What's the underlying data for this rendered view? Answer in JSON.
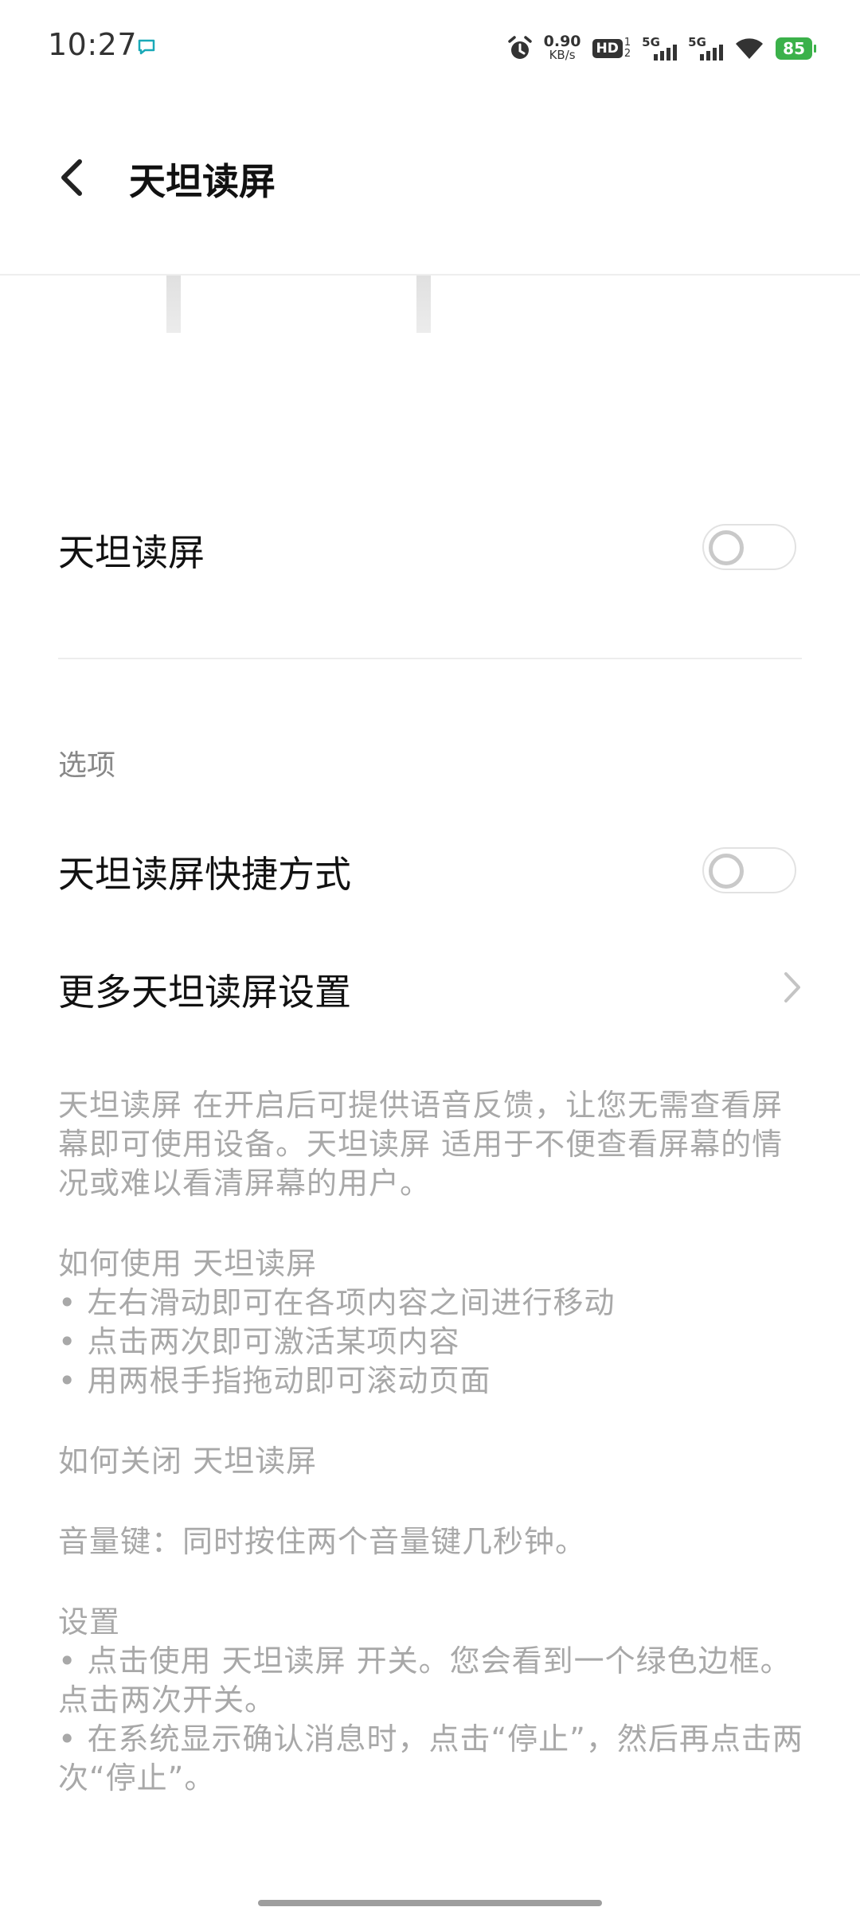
{
  "status_bar": {
    "time": "10:27",
    "net_speed_value": "0.90",
    "net_speed_unit": "KB/s",
    "hd_label": "HD",
    "hd_sim_top": "1",
    "hd_sim_bottom": "2",
    "sim1_type": "5G",
    "sim2_type": "5G",
    "battery": "85",
    "battery_color": "#3bb14a"
  },
  "header": {
    "title": "天坦读屏"
  },
  "main_toggle": {
    "label": "天坦读屏",
    "on": false
  },
  "options_section": {
    "header": "选项",
    "shortcut_label": "天坦读屏快捷方式",
    "shortcut_on": false,
    "more_settings_label": "更多天坦读屏设置"
  },
  "description": {
    "intro": "天坦读屏 在开启后可提供语音反馈，让您无需查看屏幕即可使用设备。天坦读屏 适用于不便查看屏幕的情况或难以看清屏幕的用户。",
    "how_to_use_title": "如何使用 天坦读屏",
    "how_to_use_items": [
      "• 左右滑动即可在各项内容之间进行移动",
      "• 点击两次即可激活某项内容",
      "• 用两根手指拖动即可滚动页面"
    ],
    "how_to_close_title": "如何关闭 天坦读屏",
    "volume_key": "音量键：同时按住两个音量键几秒钟。",
    "settings_title": "设置",
    "settings_items": [
      "• 点击使用 天坦读屏 开关。您会看到一个绿色边框。点击两次开关。",
      "• 在系统显示确认消息时，点击“停止”，然后再点击两次“停止”。"
    ]
  }
}
